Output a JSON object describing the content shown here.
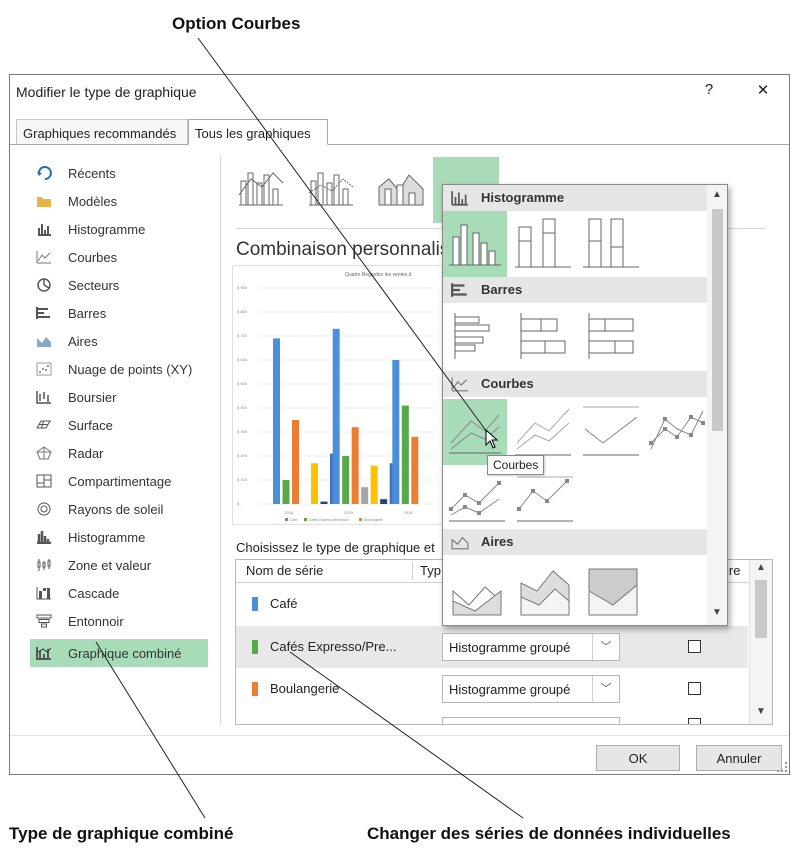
{
  "callouts": {
    "top": "Option Courbes",
    "bottom_left": "Type de graphique combiné",
    "bottom_right": "Changer des séries de données individuelles"
  },
  "dialog": {
    "title": "Modifier le type de graphique",
    "help": "?",
    "close": "✕",
    "tabs": [
      {
        "label": "Graphiques recommandés",
        "active": false
      },
      {
        "label": "Tous les graphiques",
        "active": true
      }
    ]
  },
  "sidebar": {
    "items": [
      {
        "label": "Récents",
        "icon": "recent-icon"
      },
      {
        "label": "Modèles",
        "icon": "folder-icon"
      },
      {
        "label": "Histogramme",
        "icon": "column-chart-icon"
      },
      {
        "label": "Courbes",
        "icon": "line-chart-icon"
      },
      {
        "label": "Secteurs",
        "icon": "pie-chart-icon"
      },
      {
        "label": "Barres",
        "icon": "bar-chart-icon"
      },
      {
        "label": "Aires",
        "icon": "area-chart-icon"
      },
      {
        "label": "Nuage de points (XY)",
        "icon": "scatter-chart-icon"
      },
      {
        "label": "Boursier",
        "icon": "stock-chart-icon"
      },
      {
        "label": "Surface",
        "icon": "surface-chart-icon"
      },
      {
        "label": "Radar",
        "icon": "radar-chart-icon"
      },
      {
        "label": "Compartimentage",
        "icon": "treemap-chart-icon"
      },
      {
        "label": "Rayons de soleil",
        "icon": "sunburst-chart-icon"
      },
      {
        "label": "Histogramme",
        "icon": "histogram-chart-icon"
      },
      {
        "label": "Zone et valeur",
        "icon": "box-whisker-chart-icon"
      },
      {
        "label": "Cascade",
        "icon": "waterfall-chart-icon"
      },
      {
        "label": "Entonnoir",
        "icon": "funnel-chart-icon"
      },
      {
        "label": "Graphique combiné",
        "icon": "combo-chart-icon",
        "selected": true
      }
    ]
  },
  "main": {
    "heading": "Combinaison personnalis",
    "preview_title": "Quatre Regardez les ventes d",
    "choose_label": "Choisissez le type de graphique et",
    "table": {
      "col_name": "Nom de série",
      "col_type": "Typ",
      "col_axis": "ire"
    },
    "rows": [
      {
        "name": "Café",
        "type": "",
        "color": "#4a90d9"
      },
      {
        "name": "Cafés Expresso/Pre...",
        "type": "Histogramme groupé",
        "color": "#59a84a"
      },
      {
        "name": "Boulangerie",
        "type": "Histogramme groupé",
        "color": "#ed7d31"
      }
    ],
    "ok": "OK",
    "cancel": "Annuler"
  },
  "gallery": {
    "sections": [
      {
        "label": "Histogramme"
      },
      {
        "label": "Barres"
      },
      {
        "label": "Courbes"
      },
      {
        "label": "Aires"
      }
    ],
    "tooltip": "Courbes"
  },
  "chart_data": {
    "type": "bar",
    "title": "Quatre Regardez les ventes d",
    "categories": [
      "2014",
      "2015",
      "2016"
    ],
    "series": [
      {
        "name": "Café",
        "values": [
          690,
          730,
          600
        ],
        "color": "#4a90d9"
      },
      {
        "name": "Cafés Expresso/Premium",
        "values": [
          100,
          200,
          410
        ],
        "color": "#59a84a"
      },
      {
        "name": "Boulangerie",
        "values": [
          350,
          320,
          280
        ],
        "color": "#ed7d31"
      },
      {
        "name": "",
        "values": [
          0,
          70,
          0
        ],
        "color": "#a5a5a5"
      },
      {
        "name": "",
        "values": [
          170,
          160,
          0
        ],
        "color": "#ffc000"
      },
      {
        "name": "",
        "values": [
          10,
          20,
          0
        ],
        "color": "#264478"
      },
      {
        "name": "",
        "values": [
          210,
          170,
          0
        ],
        "color": "#4472c4"
      }
    ],
    "ylim": [
      0,
      800
    ],
    "ytick_labels": [
      "$ 900",
      "$ 800",
      "$ 700",
      "$ 600",
      "$ 500",
      "$ 400",
      "$ 300",
      "$ 200",
      "$ 100",
      "$ -"
    ]
  }
}
